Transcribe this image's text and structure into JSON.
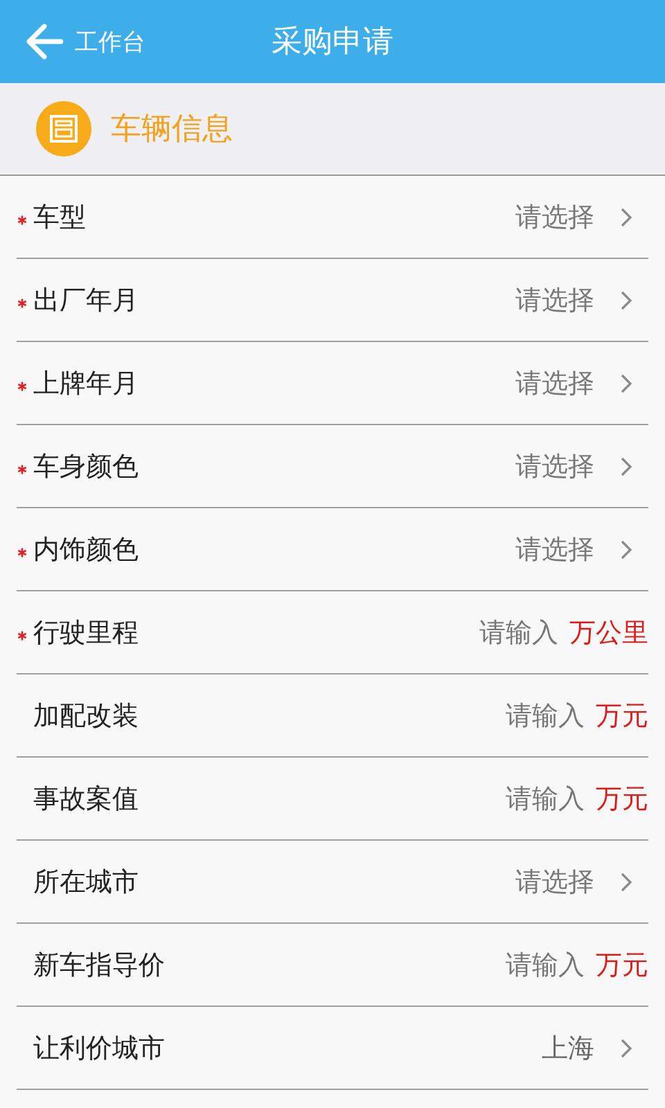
{
  "header": {
    "back_label": "工作台",
    "title": "采购申请"
  },
  "section": {
    "title": "车辆信息"
  },
  "rows": [
    {
      "label": "车型",
      "required": true,
      "kind": "select",
      "placeholder": "请选择"
    },
    {
      "label": "出厂年月",
      "required": true,
      "kind": "select",
      "placeholder": "请选择"
    },
    {
      "label": "上牌年月",
      "required": true,
      "kind": "select",
      "placeholder": "请选择"
    },
    {
      "label": "车身颜色",
      "required": true,
      "kind": "select",
      "placeholder": "请选择"
    },
    {
      "label": "内饰颜色",
      "required": true,
      "kind": "select",
      "placeholder": "请选择"
    },
    {
      "label": "行驶里程",
      "required": true,
      "kind": "input",
      "placeholder": "请输入",
      "unit": "万公里"
    },
    {
      "label": "加配改装",
      "required": false,
      "kind": "input",
      "placeholder": "请输入",
      "unit": "万元"
    },
    {
      "label": "事故案值",
      "required": false,
      "kind": "input",
      "placeholder": "请输入",
      "unit": "万元"
    },
    {
      "label": "所在城市",
      "required": false,
      "kind": "select",
      "placeholder": "请选择"
    },
    {
      "label": "新车指导价",
      "required": false,
      "kind": "input",
      "placeholder": "请输入",
      "unit": "万元"
    },
    {
      "label": "让利价城市",
      "required": false,
      "kind": "select",
      "value": "上海"
    }
  ]
}
